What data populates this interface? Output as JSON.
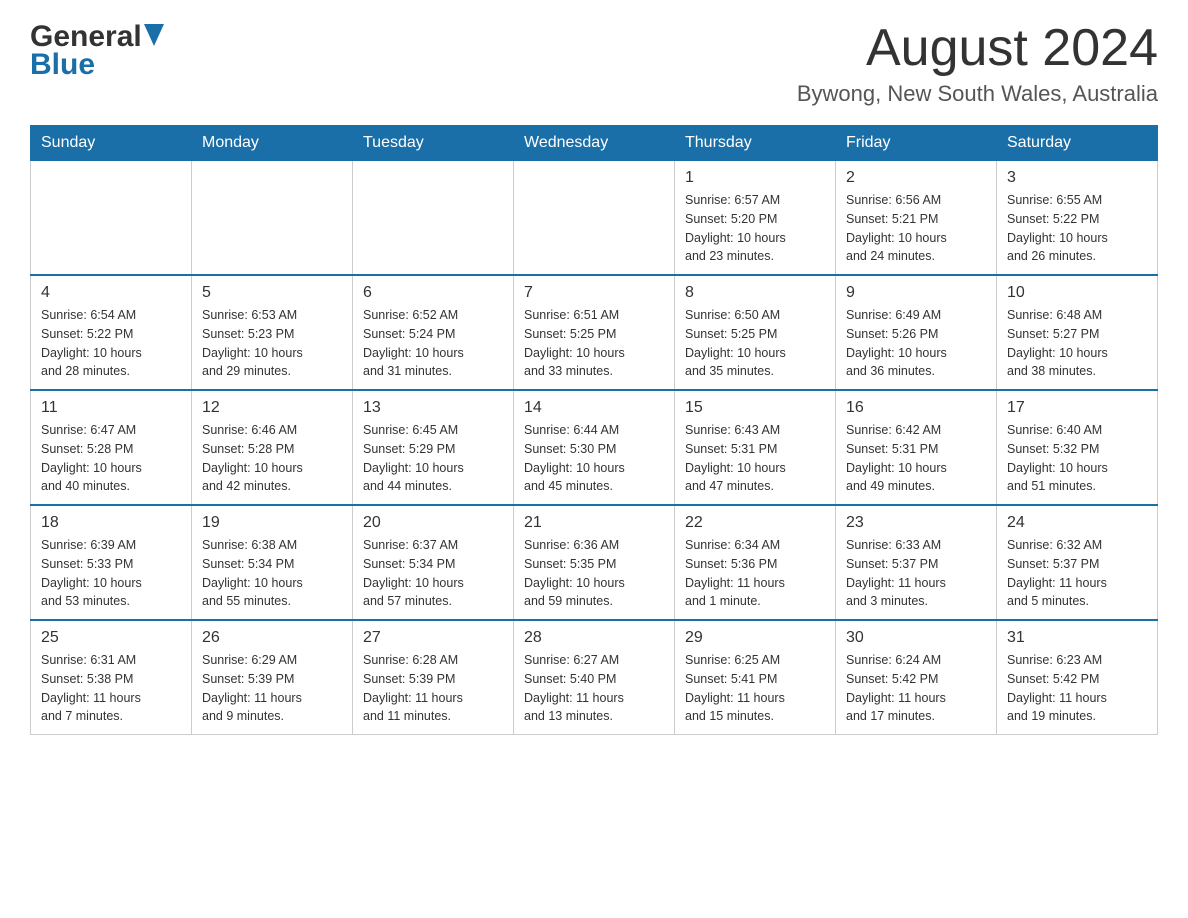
{
  "header": {
    "logo_text_black": "General",
    "logo_text_blue": "Blue",
    "month_title": "August 2024",
    "location": "Bywong, New South Wales, Australia"
  },
  "days_of_week": [
    "Sunday",
    "Monday",
    "Tuesday",
    "Wednesday",
    "Thursday",
    "Friday",
    "Saturday"
  ],
  "weeks": [
    [
      {
        "day": "",
        "info": ""
      },
      {
        "day": "",
        "info": ""
      },
      {
        "day": "",
        "info": ""
      },
      {
        "day": "",
        "info": ""
      },
      {
        "day": "1",
        "info": "Sunrise: 6:57 AM\nSunset: 5:20 PM\nDaylight: 10 hours\nand 23 minutes."
      },
      {
        "day": "2",
        "info": "Sunrise: 6:56 AM\nSunset: 5:21 PM\nDaylight: 10 hours\nand 24 minutes."
      },
      {
        "day": "3",
        "info": "Sunrise: 6:55 AM\nSunset: 5:22 PM\nDaylight: 10 hours\nand 26 minutes."
      }
    ],
    [
      {
        "day": "4",
        "info": "Sunrise: 6:54 AM\nSunset: 5:22 PM\nDaylight: 10 hours\nand 28 minutes."
      },
      {
        "day": "5",
        "info": "Sunrise: 6:53 AM\nSunset: 5:23 PM\nDaylight: 10 hours\nand 29 minutes."
      },
      {
        "day": "6",
        "info": "Sunrise: 6:52 AM\nSunset: 5:24 PM\nDaylight: 10 hours\nand 31 minutes."
      },
      {
        "day": "7",
        "info": "Sunrise: 6:51 AM\nSunset: 5:25 PM\nDaylight: 10 hours\nand 33 minutes."
      },
      {
        "day": "8",
        "info": "Sunrise: 6:50 AM\nSunset: 5:25 PM\nDaylight: 10 hours\nand 35 minutes."
      },
      {
        "day": "9",
        "info": "Sunrise: 6:49 AM\nSunset: 5:26 PM\nDaylight: 10 hours\nand 36 minutes."
      },
      {
        "day": "10",
        "info": "Sunrise: 6:48 AM\nSunset: 5:27 PM\nDaylight: 10 hours\nand 38 minutes."
      }
    ],
    [
      {
        "day": "11",
        "info": "Sunrise: 6:47 AM\nSunset: 5:28 PM\nDaylight: 10 hours\nand 40 minutes."
      },
      {
        "day": "12",
        "info": "Sunrise: 6:46 AM\nSunset: 5:28 PM\nDaylight: 10 hours\nand 42 minutes."
      },
      {
        "day": "13",
        "info": "Sunrise: 6:45 AM\nSunset: 5:29 PM\nDaylight: 10 hours\nand 44 minutes."
      },
      {
        "day": "14",
        "info": "Sunrise: 6:44 AM\nSunset: 5:30 PM\nDaylight: 10 hours\nand 45 minutes."
      },
      {
        "day": "15",
        "info": "Sunrise: 6:43 AM\nSunset: 5:31 PM\nDaylight: 10 hours\nand 47 minutes."
      },
      {
        "day": "16",
        "info": "Sunrise: 6:42 AM\nSunset: 5:31 PM\nDaylight: 10 hours\nand 49 minutes."
      },
      {
        "day": "17",
        "info": "Sunrise: 6:40 AM\nSunset: 5:32 PM\nDaylight: 10 hours\nand 51 minutes."
      }
    ],
    [
      {
        "day": "18",
        "info": "Sunrise: 6:39 AM\nSunset: 5:33 PM\nDaylight: 10 hours\nand 53 minutes."
      },
      {
        "day": "19",
        "info": "Sunrise: 6:38 AM\nSunset: 5:34 PM\nDaylight: 10 hours\nand 55 minutes."
      },
      {
        "day": "20",
        "info": "Sunrise: 6:37 AM\nSunset: 5:34 PM\nDaylight: 10 hours\nand 57 minutes."
      },
      {
        "day": "21",
        "info": "Sunrise: 6:36 AM\nSunset: 5:35 PM\nDaylight: 10 hours\nand 59 minutes."
      },
      {
        "day": "22",
        "info": "Sunrise: 6:34 AM\nSunset: 5:36 PM\nDaylight: 11 hours\nand 1 minute."
      },
      {
        "day": "23",
        "info": "Sunrise: 6:33 AM\nSunset: 5:37 PM\nDaylight: 11 hours\nand 3 minutes."
      },
      {
        "day": "24",
        "info": "Sunrise: 6:32 AM\nSunset: 5:37 PM\nDaylight: 11 hours\nand 5 minutes."
      }
    ],
    [
      {
        "day": "25",
        "info": "Sunrise: 6:31 AM\nSunset: 5:38 PM\nDaylight: 11 hours\nand 7 minutes."
      },
      {
        "day": "26",
        "info": "Sunrise: 6:29 AM\nSunset: 5:39 PM\nDaylight: 11 hours\nand 9 minutes."
      },
      {
        "day": "27",
        "info": "Sunrise: 6:28 AM\nSunset: 5:39 PM\nDaylight: 11 hours\nand 11 minutes."
      },
      {
        "day": "28",
        "info": "Sunrise: 6:27 AM\nSunset: 5:40 PM\nDaylight: 11 hours\nand 13 minutes."
      },
      {
        "day": "29",
        "info": "Sunrise: 6:25 AM\nSunset: 5:41 PM\nDaylight: 11 hours\nand 15 minutes."
      },
      {
        "day": "30",
        "info": "Sunrise: 6:24 AM\nSunset: 5:42 PM\nDaylight: 11 hours\nand 17 minutes."
      },
      {
        "day": "31",
        "info": "Sunrise: 6:23 AM\nSunset: 5:42 PM\nDaylight: 11 hours\nand 19 minutes."
      }
    ]
  ]
}
